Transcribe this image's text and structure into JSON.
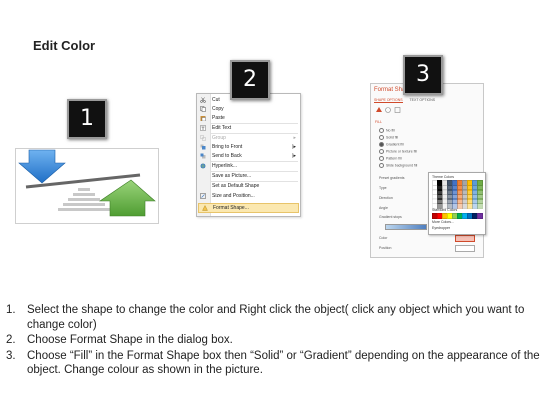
{
  "title": "Edit Color",
  "badges": [
    "1",
    "2",
    "3"
  ],
  "context_menu": {
    "items": [
      {
        "label": "Cut",
        "icon": "scissors-icon"
      },
      {
        "label": "Copy",
        "icon": "copy-icon"
      },
      {
        "label": "Paste",
        "icon": "paste-icon"
      },
      {
        "label": "Edit Text",
        "icon": "text-icon"
      },
      {
        "label": "Group",
        "icon": "group-icon",
        "submenu": true,
        "disabled": true
      },
      {
        "label": "Bring to Front",
        "icon": "bring-front-icon",
        "submenu": true
      },
      {
        "label": "Send to Back",
        "icon": "send-back-icon",
        "submenu": true
      },
      {
        "label": "Hyperlink...",
        "icon": "hyperlink-icon"
      },
      {
        "label": "Save as Picture...",
        "icon": ""
      },
      {
        "label": "Set as Default Shape",
        "icon": ""
      },
      {
        "label": "Size and Position...",
        "icon": "size-icon"
      },
      {
        "label": "Format Shape...",
        "icon": "format-shape-icon",
        "highlighted": true
      }
    ]
  },
  "format_pane": {
    "title": "Format Shape",
    "tabs": [
      "SHAPE OPTIONS",
      "TEXT OPTIONS"
    ],
    "section": "FILL",
    "fill_options": [
      "No fill",
      "Solid fill",
      "Gradient fill",
      "Picture or texture fill",
      "Pattern fill",
      "Slide background fill"
    ],
    "fields": [
      "Preset gradients",
      "Type",
      "Direction",
      "Angle",
      "Gradient stops",
      "Color",
      "Position"
    ],
    "picker": {
      "theme_label": "Theme Colors",
      "standard_label": "Standard Colors",
      "more_colors": "More Colors...",
      "eyedropper": "Eyedropper"
    }
  },
  "instructions": [
    {
      "num": "1.",
      "text": "Select the shape to change the color and Right click the object( click any object which you want to change color)"
    },
    {
      "num": "2.",
      "text": "Choose Format Shape in the dialog box."
    },
    {
      "num": "3.",
      "text": "Choose “Fill” in the Format Shape box then “Solid” or “Gradient” depending on the appearance of the object. Change colour as shown in the picture."
    }
  ],
  "colors": {
    "arrow_blue": "#2f7ed8",
    "arrow_green": "#66b347",
    "accent_orange": "#d04a2b"
  }
}
